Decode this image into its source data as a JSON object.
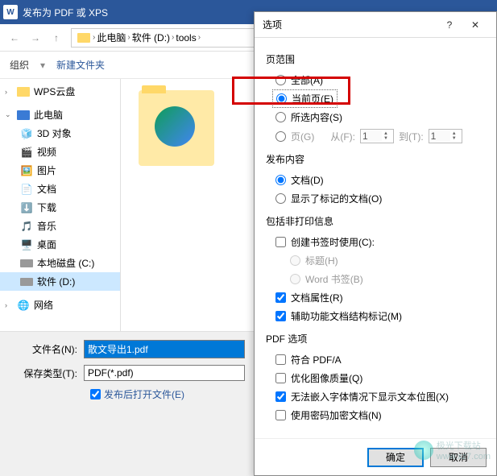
{
  "saveDialog": {
    "title": "发布为 PDF 或 XPS",
    "appIconLetter": "W",
    "nav": {
      "path": [
        "此电脑",
        "软件 (D:)",
        "tools"
      ]
    },
    "toolbar": {
      "organize": "组织",
      "newFolder": "新建文件夹"
    },
    "sidebar": [
      {
        "label": "WPS云盘",
        "icon": "folder"
      },
      {
        "label": "此电脑",
        "icon": "pc",
        "expanded": true
      },
      {
        "label": "3D 对象",
        "icon": "3d",
        "indent": 1
      },
      {
        "label": "视频",
        "icon": "video",
        "indent": 1
      },
      {
        "label": "图片",
        "icon": "pictures",
        "indent": 1
      },
      {
        "label": "文档",
        "icon": "docs",
        "indent": 1
      },
      {
        "label": "下载",
        "icon": "downloads",
        "indent": 1
      },
      {
        "label": "音乐",
        "icon": "music",
        "indent": 1
      },
      {
        "label": "桌面",
        "icon": "desktop",
        "indent": 1
      },
      {
        "label": "本地磁盘 (C:)",
        "icon": "drive",
        "indent": 1
      },
      {
        "label": "软件 (D:)",
        "icon": "drive",
        "indent": 1,
        "selected": true
      },
      {
        "label": "网络",
        "icon": "network"
      }
    ],
    "filenameLabel": "文件名(N):",
    "filenameValue": "散文导出1.pdf",
    "typeLabel": "保存类型(T):",
    "typeValue": "PDF(*.pdf)",
    "openAfter": "发布后打开文件(E)",
    "openAfterChecked": true
  },
  "options": {
    "title": "选项",
    "pageRange": {
      "title": "页范围",
      "all": "全部(A)",
      "current": "当前页(E)",
      "selection": "所选内容(S)",
      "pages": "页(G)",
      "fromLabel": "从(F):",
      "fromValue": "1",
      "toLabel": "到(T):",
      "toValue": "1",
      "selected": "current"
    },
    "publishContent": {
      "title": "发布内容",
      "document": "文档(D)",
      "showMarkup": "显示了标记的文档(O)",
      "selected": "document"
    },
    "nonPrintInfo": {
      "title": "包括非打印信息",
      "createBookmarks": "创建书签时使用(C):",
      "createBookmarksChecked": false,
      "headings": "标题(H)",
      "wordBookmarks": "Word 书签(B)",
      "docProps": "文档属性(R)",
      "docPropsChecked": true,
      "accessibility": "辅助功能文档结构标记(M)",
      "accessibilityChecked": true
    },
    "pdfOptions": {
      "title": "PDF 选项",
      "pdfa": "符合 PDF/A",
      "pdfaChecked": false,
      "optimizeQuality": "优化图像质量(Q)",
      "optimizeQualityChecked": false,
      "bitmapText": "无法嵌入字体情况下显示文本位图(X)",
      "bitmapTextChecked": true,
      "encrypt": "使用密码加密文档(N)",
      "encryptChecked": false
    },
    "buttons": {
      "ok": "确定",
      "cancel": "取消"
    }
  },
  "watermark": {
    "text1": "极光下载站",
    "text2": "www.xz7.com"
  }
}
